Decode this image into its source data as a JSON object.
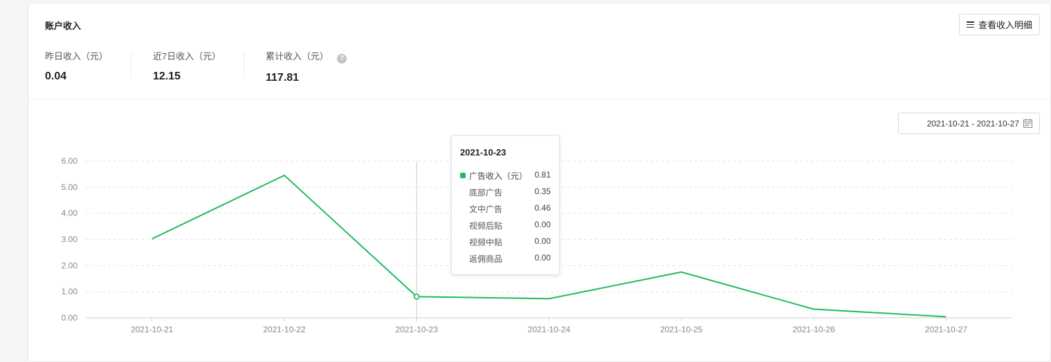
{
  "header": {
    "title": "账户收入",
    "detail_button_label": "查看收入明细"
  },
  "stats": [
    {
      "label": "昨日收入（元）",
      "value": "0.04"
    },
    {
      "label": "近7日收入（元）",
      "value": "12.15"
    },
    {
      "label": "累计收入（元）",
      "value": "117.81",
      "help": "?"
    }
  ],
  "date_range": {
    "value": "2021-10-21 - 2021-10-27",
    "icon": "calendar-icon"
  },
  "chart_data": {
    "type": "line",
    "categories": [
      "2021-10-21",
      "2021-10-22",
      "2021-10-23",
      "2021-10-24",
      "2021-10-25",
      "2021-10-26",
      "2021-10-27"
    ],
    "series": [
      {
        "values": [
          3.02,
          5.45,
          0.81,
          0.73,
          1.75,
          0.33,
          0.04
        ]
      }
    ],
    "y_ticks": [
      "0.00",
      "1.00",
      "2.00",
      "3.00",
      "4.00",
      "5.00",
      "6.00"
    ],
    "ylim": [
      0,
      6
    ],
    "grid": "horizontal-dashed",
    "line_color": "#1ebc5d",
    "highlight_index": 2
  },
  "tooltip": {
    "date": "2021-10-23",
    "main": {
      "name": "广告收入（元）",
      "value": "0.81"
    },
    "rows": [
      {
        "name": "底部广告",
        "value": "0.35"
      },
      {
        "name": "文中广告",
        "value": "0.46"
      },
      {
        "name": "视频后贴",
        "value": "0.00"
      },
      {
        "name": "视频中贴",
        "value": "0.00"
      },
      {
        "name": "返佣商品",
        "value": "0.00"
      }
    ]
  }
}
